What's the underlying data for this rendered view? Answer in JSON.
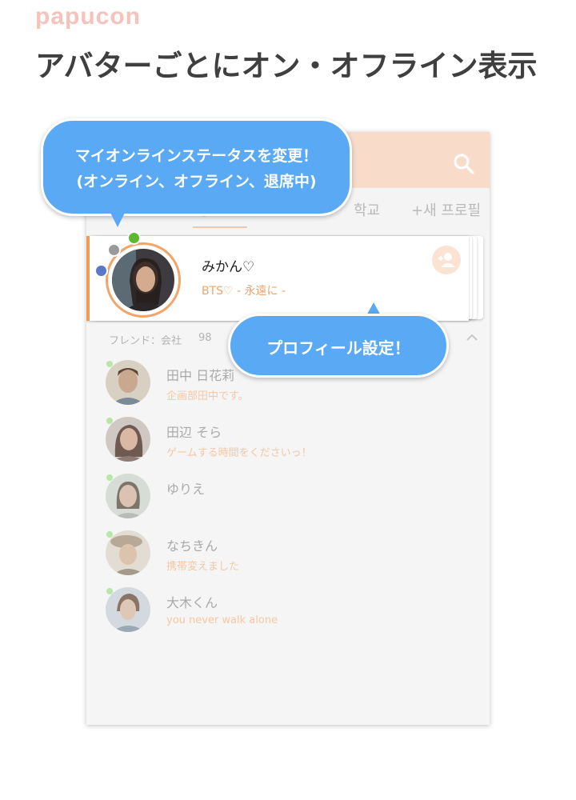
{
  "brand": {
    "logo_text": "papucon"
  },
  "headline": "アバターごとにオン・オフライン表示",
  "app": {
    "tabs": [
      {
        "label": "学"
      },
      {
        "label": ""
      },
      {
        "label": "학교"
      },
      {
        "label": "+새 프로필"
      }
    ],
    "my_profile": {
      "name": "みかん♡",
      "status": "BTS♡ - 永遠に -",
      "status_colors": {
        "online": "#5cb82e",
        "offline": "#9a9a9a",
        "away": "#5a78c8"
      }
    },
    "section": {
      "title": "フレンド：会社",
      "count": "98"
    },
    "friends": [
      {
        "name": "田中 日花莉",
        "status": "企画部田中です。",
        "avatar_color": "#9c7a61"
      },
      {
        "name": "田辺 そら",
        "status": "ゲームする時間をくださいっ！",
        "avatar_color": "#7d6b64"
      },
      {
        "name": "ゆりえ",
        "status": "",
        "avatar_color": "#8a8f88"
      },
      {
        "name": "なちきん",
        "status": "携帯変えました",
        "avatar_color": "#a59887"
      },
      {
        "name": "大木くん",
        "status": " you never walk alone",
        "avatar_color": "#8f9aa3"
      }
    ]
  },
  "callouts": {
    "status_line1": "マイオンラインステータスを変更！",
    "status_line2": "(オンライン、オフライン、退席中)",
    "profile": "プロフィール設定！"
  },
  "colors": {
    "appbar": "#f8dcc9",
    "accent_orange": "#f19a55",
    "bubble_blue": "#5aa9f5",
    "brand_pink": "#f6c2bc"
  }
}
